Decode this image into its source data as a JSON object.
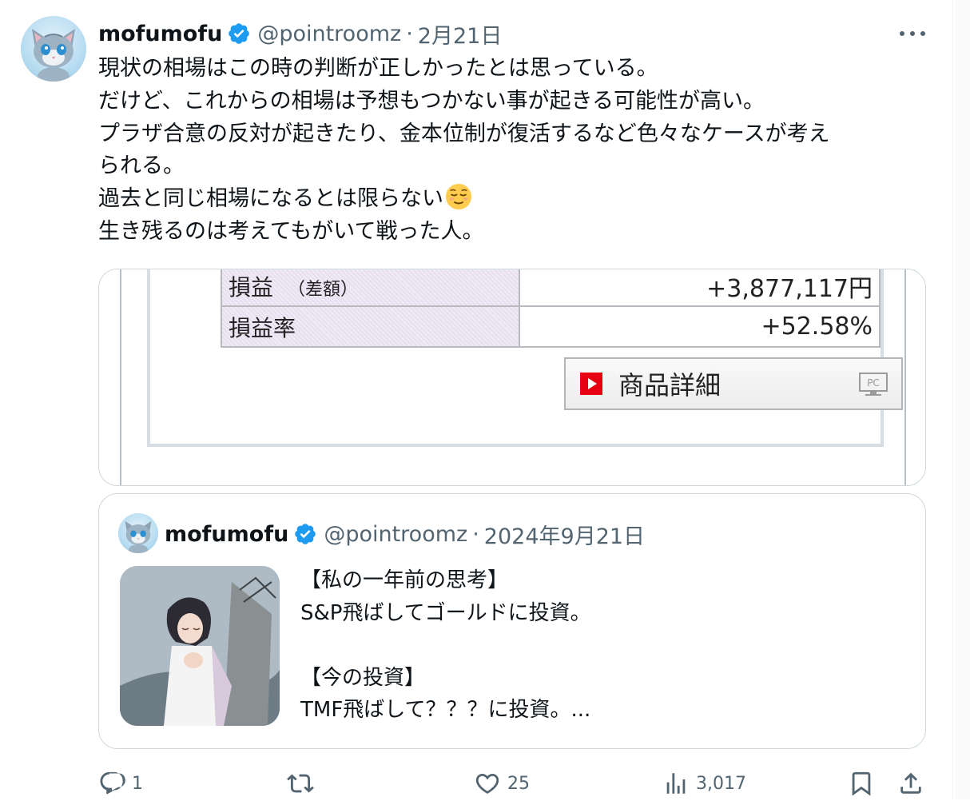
{
  "tweet": {
    "author_name": "mofumofu",
    "handle": "@pointroomz",
    "separator": "·",
    "date": "2月21日",
    "text_lines": [
      "現状の相場はこの時の判断が正しかったとは思っている。",
      "だけど、これからの相場は予想もつかない事が起きる可能性が高い。",
      "プラザ合意の反対が起きたり、金本位制が復活するなど色々なケースが考え",
      "られる。",
      "過去と同じ相場になるとは限らない",
      "生き残るのは考えてもがいて戦った人。"
    ],
    "emoji_name": "relieved-face-emoji"
  },
  "media": {
    "rows": [
      {
        "label": "損益",
        "label_note": "（差額）",
        "value": "+3,877,117円"
      },
      {
        "label": "損益率",
        "label_note": "",
        "value": "+52.58%"
      }
    ],
    "detail_button": "商品詳細",
    "pc_badge": "PC"
  },
  "quote": {
    "author_name": "mofumofu",
    "handle": "@pointroomz",
    "separator": "·",
    "date": "2024年9月21日",
    "lines": [
      "【私の一年前の思考】",
      "S&P飛ばしてゴールドに投資。",
      "",
      "【今の投資】",
      "TMF飛ばして？？？に投資。..."
    ]
  },
  "actions": {
    "replies": "1",
    "retweets": "",
    "likes": "25",
    "views": "3,017"
  },
  "colors": {
    "verified": "#1d9bf0",
    "secondary_text": "#536471",
    "border": "#cfd9de",
    "play_red": "#e60012"
  }
}
